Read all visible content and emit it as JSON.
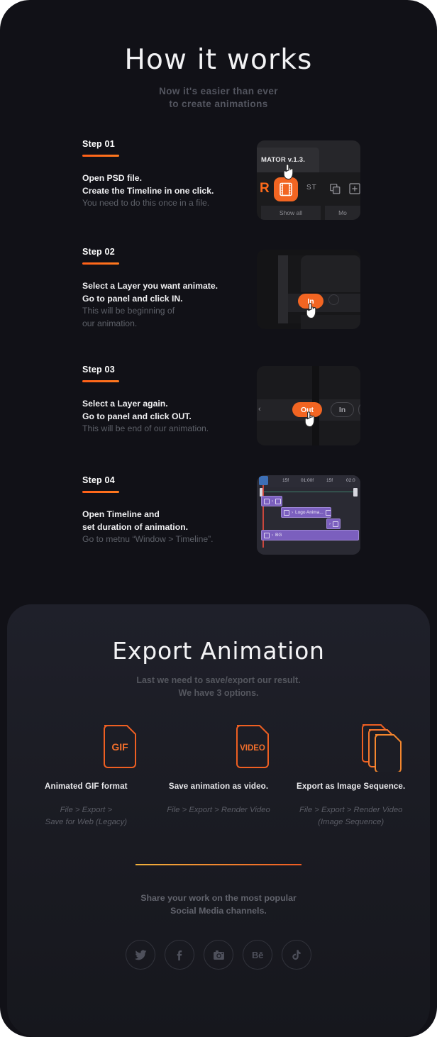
{
  "hero": {
    "title": "How it works",
    "subtitle_line1": "Now it's easier than ever",
    "subtitle_line2": "to create animations"
  },
  "accent": "#f26522",
  "accent_alt": "#ff5f18",
  "page_bg": "#111117",
  "panel_bg": "#1c1d25",
  "steps": [
    {
      "badge": "Step 01",
      "bold_line1": "Open PSD file.",
      "bold_line2": "Create the Timeline in one click.",
      "muted_line1": "You need to do this once in a file.",
      "muted_line2": "",
      "shot": {
        "tab_label": "MATOR v.1.3.",
        "logo_letter": "R",
        "tool_text": "ST",
        "active_icon": "film-strip-icon",
        "icon_2": "duplicate-layer-icon",
        "icon_3": "add-frame-icon",
        "button_1": "Show all",
        "button_2": "Mo",
        "cursor": "hand-pointer-cursor"
      }
    },
    {
      "badge": "Step 02",
      "bold_line1": "Select a Layer you want animate.",
      "bold_line2": "Go to panel and click IN.",
      "muted_line1": "This will be beginning of",
      "muted_line2": "our animation.",
      "shot": {
        "pill_active": "In",
        "cursor": "hand-pointer-cursor"
      }
    },
    {
      "badge": "Step 03",
      "bold_line1": "Select a Layer again.",
      "bold_line2": "Go to panel and click OUT.",
      "muted_line1": "This will be end of our animation.",
      "muted_line2": "",
      "shot": {
        "pill_active": "Out",
        "pill_ghost": "In",
        "cursor": "hand-pointer-cursor"
      }
    },
    {
      "badge": "Step 04",
      "bold_line1": "Open Timeline and",
      "bold_line2": "set duration of animation.",
      "muted_line1": "Go to metnu “Window > Timeline”.",
      "muted_line2": "",
      "shot": {
        "ruler_ticks": [
          "15f",
          "01:00f",
          "15f",
          "02:0"
        ],
        "layers": [
          {
            "label": ""
          },
          {
            "label": "Logo Anima..."
          },
          {
            "label": ""
          },
          {
            "label": "BG"
          }
        ]
      }
    }
  ],
  "export": {
    "title": "Export Animation",
    "subtitle_line1": "Last we need to save/export our result.",
    "subtitle_line2": "We have 3 options.",
    "options": [
      {
        "icon_text": "GIF",
        "icon_name": "gif-file-icon",
        "label": "Animated GIF format",
        "path_line1": "File > Export >",
        "path_line2": "Save for Web (Legacy)"
      },
      {
        "icon_text": "VIDEO",
        "icon_name": "video-file-icon",
        "label": "Save animation as video.",
        "path_line1": "File > Export > Render Video",
        "path_line2": ""
      },
      {
        "icon_text": "",
        "icon_name": "image-sequence-icon",
        "label": "Export as Image Sequence.",
        "path_line1": "File > Export > Render Video",
        "path_line2": "(Image Sequence)"
      }
    ],
    "divider_gradient_from": "#f0b03c",
    "divider_gradient_to": "#ee5b22",
    "share_line1": "Share your work on the most popular",
    "share_line2": "Social Media channels.",
    "socials": [
      {
        "name": "twitter-icon",
        "label": ""
      },
      {
        "name": "facebook-icon",
        "label": "f"
      },
      {
        "name": "instagram-icon",
        "label": ""
      },
      {
        "name": "behance-icon",
        "label": "Bē"
      },
      {
        "name": "tiktok-icon",
        "label": ""
      }
    ]
  }
}
